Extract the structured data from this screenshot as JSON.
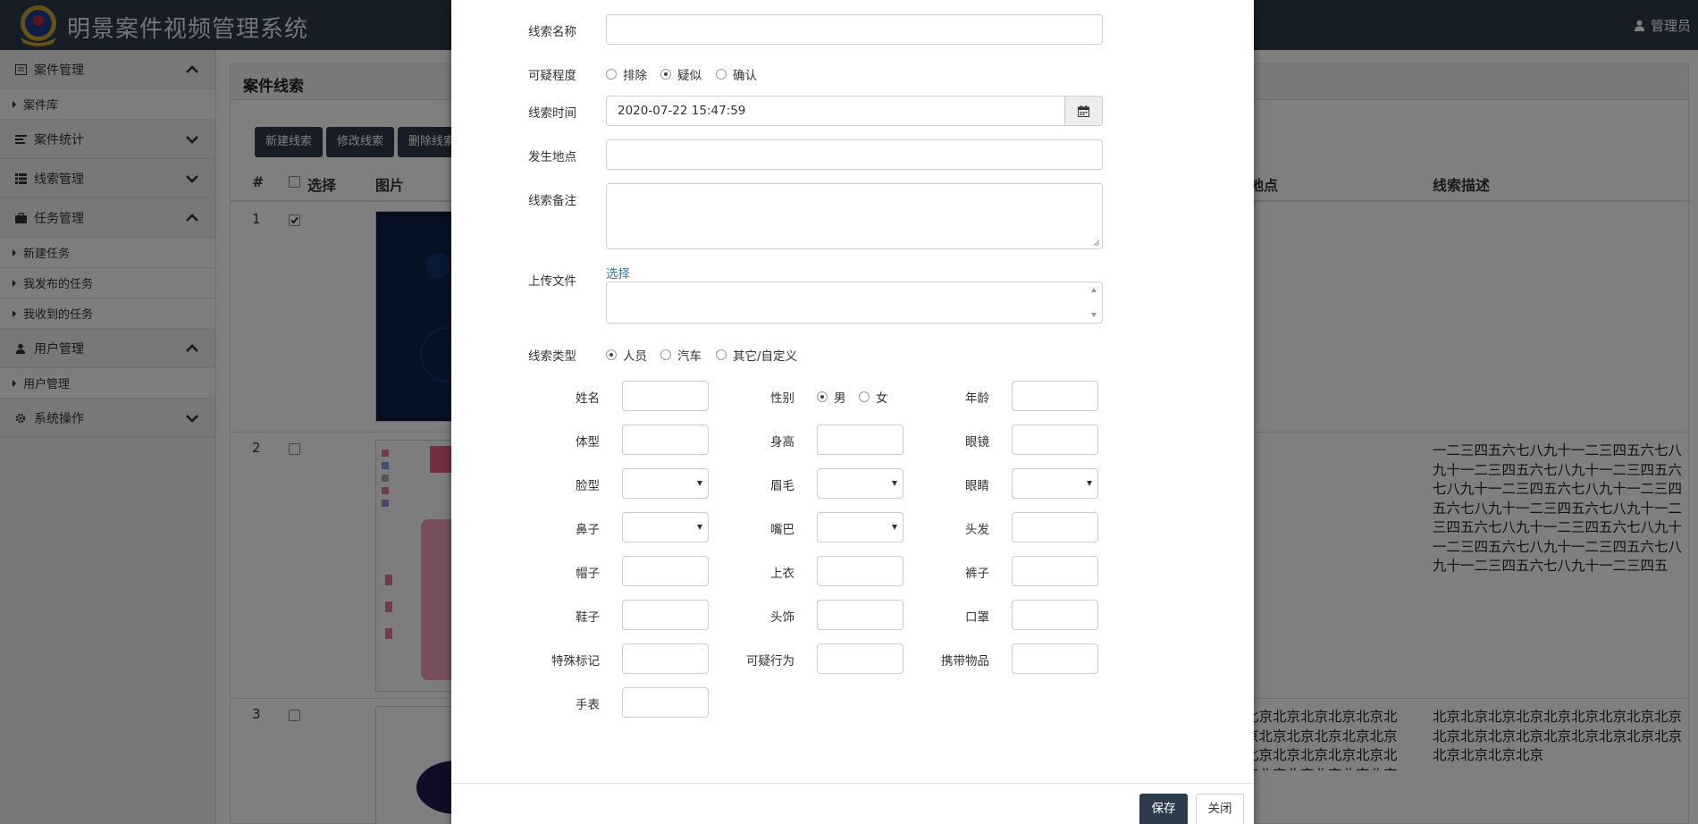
{
  "app": {
    "title": "明景案件视频管理系统",
    "user": "管理员"
  },
  "sidebar": {
    "groups": [
      {
        "label": "案件管理",
        "icon": "list-icon",
        "items": [
          "案件库"
        ]
      },
      {
        "label": "案件统计",
        "icon": "align-left-icon",
        "items": []
      },
      {
        "label": "线索管理",
        "icon": "th-list-icon",
        "items": []
      },
      {
        "label": "任务管理",
        "icon": "briefcase-icon",
        "items": [
          "新建任务",
          "我发布的任务",
          "我收到的任务"
        ]
      },
      {
        "label": "用户管理",
        "icon": "user-icon",
        "items": [
          "用户管理"
        ]
      },
      {
        "label": "系统操作",
        "icon": "gear-icon",
        "items": []
      }
    ]
  },
  "main": {
    "panel_title": "案件线索",
    "toolbar": {
      "new": "新建线索",
      "edit": "修改线索",
      "delete": "删除线索"
    },
    "columns": {
      "num": "#",
      "select": "选择",
      "image": "图片",
      "place": "地点",
      "desc": "线索描述"
    },
    "rows": [
      {
        "num": "1",
        "checked": true,
        "place": "",
        "desc": ""
      },
      {
        "num": "2",
        "checked": false,
        "place": "",
        "desc": "一二三四五六七八九十一二三四五六七八九十一二三四五六七八九十一二三四五六七八九十一二三四五六七八九十一二三四五六七八九十一二三四五六七八九十一二三四五六七八九十一二三四五六七八九十一二三四五六七八九十一二三四五六七八九十一二三四五六七八九十一二三四五"
      },
      {
        "num": "3",
        "checked": false,
        "place": "北京北京北京北京北京北京北京北京北京北京北京北京北京北京北京北京北京北京北京北京北京北京",
        "desc": "北京北京北京北京北京北京北京北京北京北京北京北京北京北京北京北京北京北京北京北京北京北京"
      }
    ]
  },
  "modal": {
    "labels": {
      "name": "线索名称",
      "suspicion": "可疑程度",
      "time": "线索时间",
      "place": "发生地点",
      "remark": "线索备注",
      "upload": "上传文件",
      "type": "线索类型"
    },
    "suspicion_options": [
      "排除",
      "疑似",
      "确认"
    ],
    "suspicion_selected": 1,
    "time_value": "2020-07-22 15:47:59",
    "upload_link": "选择",
    "type_options": [
      "人员",
      "汽车",
      "其它/自定义"
    ],
    "type_selected": 0,
    "person": {
      "name": "姓名",
      "gender": "性别",
      "age": "年龄",
      "gender_options": [
        "男",
        "女"
      ],
      "gender_selected": 0,
      "build": "体型",
      "height": "身高",
      "glasses": "眼镜",
      "face": "脸型",
      "eyebrow": "眉毛",
      "eyes": "眼睛",
      "nose": "鼻子",
      "mouth": "嘴巴",
      "hair": "头发",
      "hat": "帽子",
      "top": "上衣",
      "pants": "裤子",
      "shoes": "鞋子",
      "headwear": "头饰",
      "mask": "口罩",
      "marks": "特殊标记",
      "behavior": "可疑行为",
      "carry": "携带物品",
      "watch": "手表"
    },
    "buttons": {
      "save": "保存",
      "close": "关闭"
    }
  }
}
